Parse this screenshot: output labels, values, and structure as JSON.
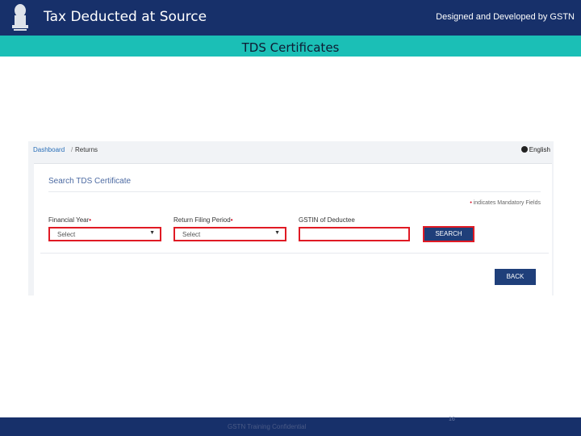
{
  "header": {
    "title": "Tax Deducted at Source",
    "credit": "Designed and Developed by GSTN"
  },
  "page": {
    "subtitle": "TDS Certificates"
  },
  "portal": {
    "breadcrumb": {
      "dashboard": "Dashboard",
      "separator": "/",
      "current": "Returns"
    },
    "language": "English",
    "card_title": "Search TDS Certificate",
    "mandatory_note": "indicates Mandatory Fields",
    "asterisk": "•",
    "fields": {
      "financial_year": {
        "label": "Financial Year",
        "value": "Select"
      },
      "return_period": {
        "label": "Return Filing Period",
        "value": "Select"
      },
      "gstin": {
        "label": "GSTIN of Deductee",
        "value": ""
      }
    },
    "search_label": "SEARCH",
    "back_label": "BACK"
  },
  "footer": {
    "text": "GSTN Training Confidential",
    "page_number": "16"
  },
  "colors": {
    "header_bg": "#17306a",
    "subbar_bg": "#1bbfb6",
    "highlight_border": "#e01a24",
    "button_bg": "#1f3f7a"
  }
}
